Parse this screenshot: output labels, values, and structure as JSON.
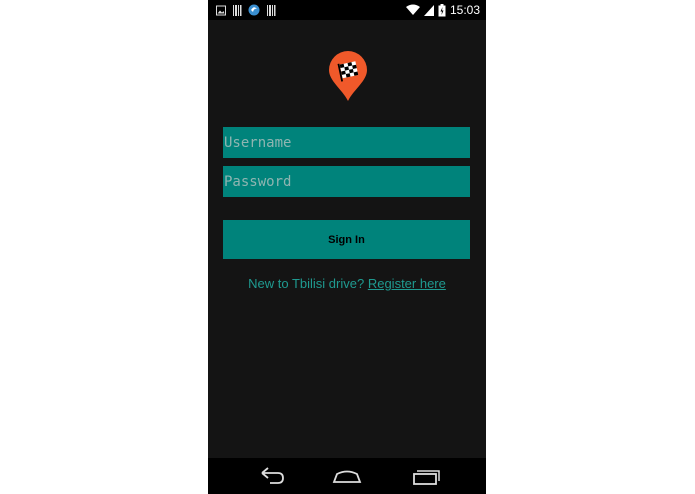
{
  "status_bar": {
    "time": "15:03",
    "left_icons": [
      "image-icon",
      "barcode-icon",
      "browser-icon",
      "barcode-icon"
    ],
    "right_icons": [
      "wifi-icon",
      "signal-icon",
      "battery-icon"
    ]
  },
  "logo": {
    "icon": "map-pin-checkered-flag-icon",
    "pin_color": "#f0592a"
  },
  "login": {
    "username_placeholder": "Username",
    "password_placeholder": "Password",
    "sign_in_label": "Sign In"
  },
  "register": {
    "prompt": "New to Tbilisi drive? ",
    "link_label": " Register here"
  },
  "nav_bar": {
    "icons": [
      "back-icon",
      "home-icon",
      "recent-apps-icon"
    ]
  },
  "colors": {
    "accent": "#00837b",
    "background": "#141414",
    "link": "#1f9a90"
  }
}
